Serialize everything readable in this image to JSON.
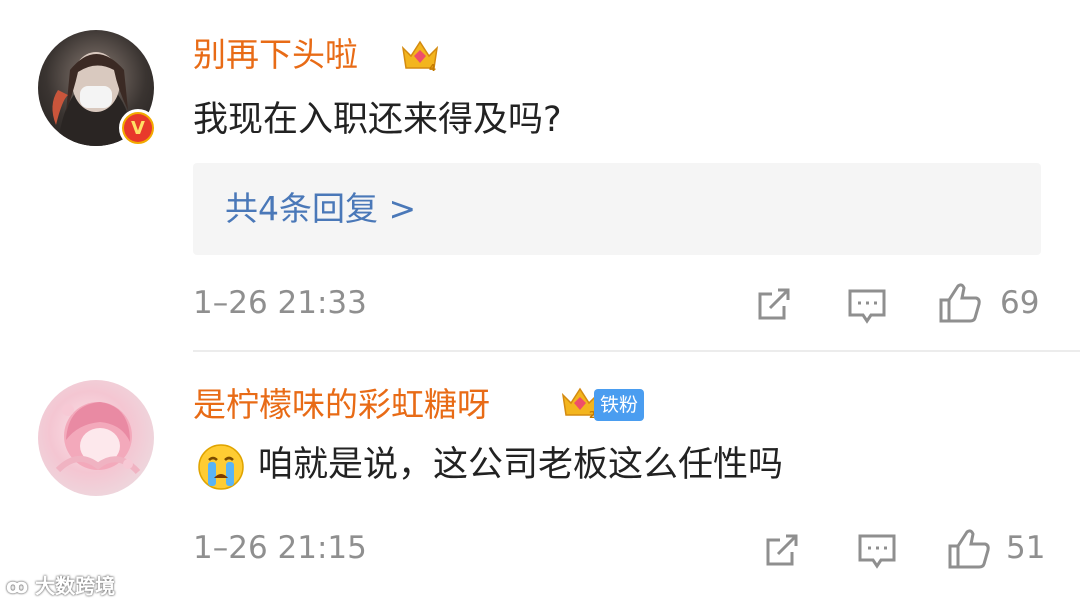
{
  "comments": [
    {
      "username": "别再下头啦",
      "verified_badge": "V",
      "text": "我现在入职还来得及吗?",
      "replies_label": "共4条回复 >",
      "timestamp": "1–26 21:33",
      "likes": "69",
      "crown_level": "4"
    },
    {
      "username": "是柠檬味的彩虹糖呀",
      "fan_badge": "铁粉",
      "text": "咱就是说，这公司老板这么任性吗",
      "emoji": "crying-face-emoji",
      "timestamp": "1–26 21:15",
      "likes": "51",
      "crown_level": "2"
    }
  ],
  "watermark": "大数跨境",
  "colors": {
    "username": "#e86b16",
    "reply_link": "#4a78b8",
    "meta": "#8f8f8f",
    "fan_badge": "#4a9df0"
  }
}
